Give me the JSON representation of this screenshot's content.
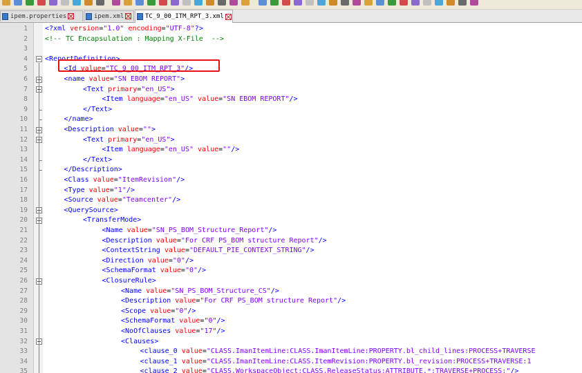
{
  "tabs": [
    {
      "label": "ipem.properties",
      "active": false
    },
    {
      "label": "ipem.xml",
      "active": false
    },
    {
      "label": "TC_9_00_ITM_RPT_3.xml",
      "active": true
    }
  ],
  "icons": {
    "file": "file-icon",
    "close": "close-icon",
    "fold": "fold-minus-icon"
  },
  "colors": {
    "tag": "#0000ff",
    "attribute": "#ff0000",
    "value": "#8000ff",
    "comment": "#008000",
    "highlight": "#e81010"
  },
  "editor": {
    "lines": [
      {
        "n": "1",
        "indent": 0,
        "parts": [
          [
            "br",
            "<?"
          ],
          [
            "tag",
            "xml"
          ],
          [
            "attr",
            " version"
          ],
          [
            "txt",
            "="
          ],
          [
            "val",
            "\"1.0\""
          ],
          [
            "attr",
            " encoding"
          ],
          [
            "txt",
            "="
          ],
          [
            "val",
            "\"UTF-8\""
          ],
          [
            "br",
            "?>"
          ]
        ]
      },
      {
        "n": "2",
        "indent": 0,
        "parts": [
          [
            "cm",
            "<!-- TC Encapsulation : Mapping X-File  -->"
          ]
        ]
      },
      {
        "n": "3",
        "indent": 0,
        "parts": []
      },
      {
        "n": "4",
        "indent": 0,
        "parts": [
          [
            "br",
            "<"
          ],
          [
            "tag",
            "ReportDefinition"
          ],
          [
            "br",
            ">"
          ]
        ]
      },
      {
        "n": "5",
        "indent": 1,
        "parts": [
          [
            "br",
            "<"
          ],
          [
            "tag",
            "Id"
          ],
          [
            "attr",
            " value"
          ],
          [
            "txt",
            "="
          ],
          [
            "val",
            "\"TC_9_00_ITM_RPT_3\""
          ],
          [
            "br",
            "/>"
          ]
        ]
      },
      {
        "n": "6",
        "indent": 1,
        "parts": [
          [
            "br",
            "<"
          ],
          [
            "tag",
            "name"
          ],
          [
            "attr",
            " value"
          ],
          [
            "txt",
            "="
          ],
          [
            "val",
            "\"SN EBOM REPORT\""
          ],
          [
            "br",
            ">"
          ]
        ]
      },
      {
        "n": "7",
        "indent": 2,
        "parts": [
          [
            "br",
            "<"
          ],
          [
            "tag",
            "Text"
          ],
          [
            "attr",
            " primary"
          ],
          [
            "txt",
            "="
          ],
          [
            "val",
            "\"en_US\""
          ],
          [
            "br",
            ">"
          ]
        ]
      },
      {
        "n": "8",
        "indent": 3,
        "parts": [
          [
            "br",
            "<"
          ],
          [
            "tag",
            "Item"
          ],
          [
            "attr",
            " language"
          ],
          [
            "txt",
            "="
          ],
          [
            "val",
            "\"en_US\""
          ],
          [
            "attr",
            " value"
          ],
          [
            "txt",
            "="
          ],
          [
            "val",
            "\"SN EBOM REPORT\""
          ],
          [
            "br",
            "/>"
          ]
        ]
      },
      {
        "n": "9",
        "indent": 2,
        "parts": [
          [
            "br",
            "</"
          ],
          [
            "tag",
            "Text"
          ],
          [
            "br",
            ">"
          ]
        ]
      },
      {
        "n": "10",
        "indent": 1,
        "parts": [
          [
            "br",
            "</"
          ],
          [
            "tag",
            "name"
          ],
          [
            "br",
            ">"
          ]
        ]
      },
      {
        "n": "11",
        "indent": 1,
        "parts": [
          [
            "br",
            "<"
          ],
          [
            "tag",
            "Description"
          ],
          [
            "attr",
            " value"
          ],
          [
            "txt",
            "="
          ],
          [
            "val",
            "\"\""
          ],
          [
            "br",
            ">"
          ]
        ]
      },
      {
        "n": "12",
        "indent": 2,
        "parts": [
          [
            "br",
            "<"
          ],
          [
            "tag",
            "Text"
          ],
          [
            "attr",
            " primary"
          ],
          [
            "txt",
            "="
          ],
          [
            "val",
            "\"en_US\""
          ],
          [
            "br",
            ">"
          ]
        ]
      },
      {
        "n": "13",
        "indent": 3,
        "parts": [
          [
            "br",
            "<"
          ],
          [
            "tag",
            "Item"
          ],
          [
            "attr",
            " language"
          ],
          [
            "txt",
            "="
          ],
          [
            "val",
            "\"en_US\""
          ],
          [
            "attr",
            " value"
          ],
          [
            "txt",
            "="
          ],
          [
            "val",
            "\"\""
          ],
          [
            "br",
            "/>"
          ]
        ]
      },
      {
        "n": "14",
        "indent": 2,
        "parts": [
          [
            "br",
            "</"
          ],
          [
            "tag",
            "Text"
          ],
          [
            "br",
            ">"
          ]
        ]
      },
      {
        "n": "15",
        "indent": 1,
        "parts": [
          [
            "br",
            "</"
          ],
          [
            "tag",
            "Description"
          ],
          [
            "br",
            ">"
          ]
        ]
      },
      {
        "n": "16",
        "indent": 1,
        "parts": [
          [
            "br",
            "<"
          ],
          [
            "tag",
            "Class"
          ],
          [
            "attr",
            " value"
          ],
          [
            "txt",
            "="
          ],
          [
            "val",
            "\"ItemRevision\""
          ],
          [
            "br",
            "/>"
          ]
        ]
      },
      {
        "n": "17",
        "indent": 1,
        "parts": [
          [
            "br",
            "<"
          ],
          [
            "tag",
            "Type"
          ],
          [
            "attr",
            " value"
          ],
          [
            "txt",
            "="
          ],
          [
            "val",
            "\"1\""
          ],
          [
            "br",
            "/>"
          ]
        ]
      },
      {
        "n": "18",
        "indent": 1,
        "parts": [
          [
            "br",
            "<"
          ],
          [
            "tag",
            "Source"
          ],
          [
            "attr",
            " value"
          ],
          [
            "txt",
            "="
          ],
          [
            "val",
            "\"Teamcenter\""
          ],
          [
            "br",
            "/>"
          ]
        ]
      },
      {
        "n": "19",
        "indent": 1,
        "parts": [
          [
            "br",
            "<"
          ],
          [
            "tag",
            "QuerySource"
          ],
          [
            "br",
            ">"
          ]
        ]
      },
      {
        "n": "20",
        "indent": 2,
        "parts": [
          [
            "br",
            "<"
          ],
          [
            "tag",
            "TransferMode"
          ],
          [
            "br",
            ">"
          ]
        ]
      },
      {
        "n": "21",
        "indent": 3,
        "parts": [
          [
            "br",
            "<"
          ],
          [
            "tag",
            "Name"
          ],
          [
            "attr",
            " value"
          ],
          [
            "txt",
            "="
          ],
          [
            "val",
            "\"SN_PS_BOM_Structure_Report\""
          ],
          [
            "br",
            "/>"
          ]
        ]
      },
      {
        "n": "22",
        "indent": 3,
        "parts": [
          [
            "br",
            "<"
          ],
          [
            "tag",
            "Description"
          ],
          [
            "attr",
            " value"
          ],
          [
            "txt",
            "="
          ],
          [
            "val",
            "\"For CRF PS_BOM structure Report\""
          ],
          [
            "br",
            "/>"
          ]
        ]
      },
      {
        "n": "23",
        "indent": 3,
        "parts": [
          [
            "br",
            "<"
          ],
          [
            "tag",
            "ContextString"
          ],
          [
            "attr",
            " value"
          ],
          [
            "txt",
            "="
          ],
          [
            "val",
            "\"DEFAULT_PIE_CONTEXT_STRING\""
          ],
          [
            "br",
            "/>"
          ]
        ]
      },
      {
        "n": "24",
        "indent": 3,
        "parts": [
          [
            "br",
            "<"
          ],
          [
            "tag",
            "Direction"
          ],
          [
            "attr",
            " value"
          ],
          [
            "txt",
            "="
          ],
          [
            "val",
            "\"0\""
          ],
          [
            "br",
            "/>"
          ]
        ]
      },
      {
        "n": "25",
        "indent": 3,
        "parts": [
          [
            "br",
            "<"
          ],
          [
            "tag",
            "SchemaFormat"
          ],
          [
            "attr",
            " value"
          ],
          [
            "txt",
            "="
          ],
          [
            "val",
            "\"0\""
          ],
          [
            "br",
            "/>"
          ]
        ]
      },
      {
        "n": "26",
        "indent": 3,
        "parts": [
          [
            "br",
            "<"
          ],
          [
            "tag",
            "ClosureRule"
          ],
          [
            "br",
            ">"
          ]
        ]
      },
      {
        "n": "27",
        "indent": 4,
        "parts": [
          [
            "br",
            "<"
          ],
          [
            "tag",
            "Name"
          ],
          [
            "attr",
            " value"
          ],
          [
            "txt",
            "="
          ],
          [
            "val",
            "\"SN_PS_BOM_Structure_CS\""
          ],
          [
            "br",
            "/>"
          ]
        ]
      },
      {
        "n": "28",
        "indent": 4,
        "parts": [
          [
            "br",
            "<"
          ],
          [
            "tag",
            "Description"
          ],
          [
            "attr",
            " value"
          ],
          [
            "txt",
            "="
          ],
          [
            "val",
            "\"For CRF PS_BOM structure Report\""
          ],
          [
            "br",
            "/>"
          ]
        ]
      },
      {
        "n": "29",
        "indent": 4,
        "parts": [
          [
            "br",
            "<"
          ],
          [
            "tag",
            "Scope"
          ],
          [
            "attr",
            " value"
          ],
          [
            "txt",
            "="
          ],
          [
            "val",
            "\"0\""
          ],
          [
            "br",
            "/>"
          ]
        ]
      },
      {
        "n": "30",
        "indent": 4,
        "parts": [
          [
            "br",
            "<"
          ],
          [
            "tag",
            "SchemaFormat"
          ],
          [
            "attr",
            " value"
          ],
          [
            "txt",
            "="
          ],
          [
            "val",
            "\"0\""
          ],
          [
            "br",
            "/>"
          ]
        ]
      },
      {
        "n": "31",
        "indent": 4,
        "parts": [
          [
            "br",
            "<"
          ],
          [
            "tag",
            "NoOfClauses"
          ],
          [
            "attr",
            " value"
          ],
          [
            "txt",
            "="
          ],
          [
            "val",
            "\"17\""
          ],
          [
            "br",
            "/>"
          ]
        ]
      },
      {
        "n": "32",
        "indent": 4,
        "parts": [
          [
            "br",
            "<"
          ],
          [
            "tag",
            "Clauses"
          ],
          [
            "br",
            ">"
          ]
        ]
      },
      {
        "n": "33",
        "indent": 5,
        "parts": [
          [
            "br",
            "<"
          ],
          [
            "tag",
            "clause_0"
          ],
          [
            "attr",
            " value"
          ],
          [
            "txt",
            "="
          ],
          [
            "val",
            "\"CLASS.ImanItemLine:CLASS.ImanItemLine:PROPERTY.bl_child_lines:PROCESS+TRAVERSE"
          ]
        ]
      },
      {
        "n": "34",
        "indent": 5,
        "parts": [
          [
            "br",
            "<"
          ],
          [
            "tag",
            "clause_1"
          ],
          [
            "attr",
            " value"
          ],
          [
            "txt",
            "="
          ],
          [
            "val",
            "\"CLASS.ImanItemLine:CLASS.ItemRevision:PROPERTY.bl_revision:PROCESS+TRAVERSE:1"
          ]
        ]
      },
      {
        "n": "35",
        "indent": 5,
        "parts": [
          [
            "br",
            "<"
          ],
          [
            "tag",
            "clause_2"
          ],
          [
            "attr",
            " value"
          ],
          [
            "txt",
            "="
          ],
          [
            "val",
            "\"CLASS.WorkspaceObject:CLASS.ReleaseStatus:ATTRIBUTE.*:TRAVERSE+PROCESS:\""
          ],
          [
            "br",
            "/>"
          ]
        ]
      }
    ]
  }
}
